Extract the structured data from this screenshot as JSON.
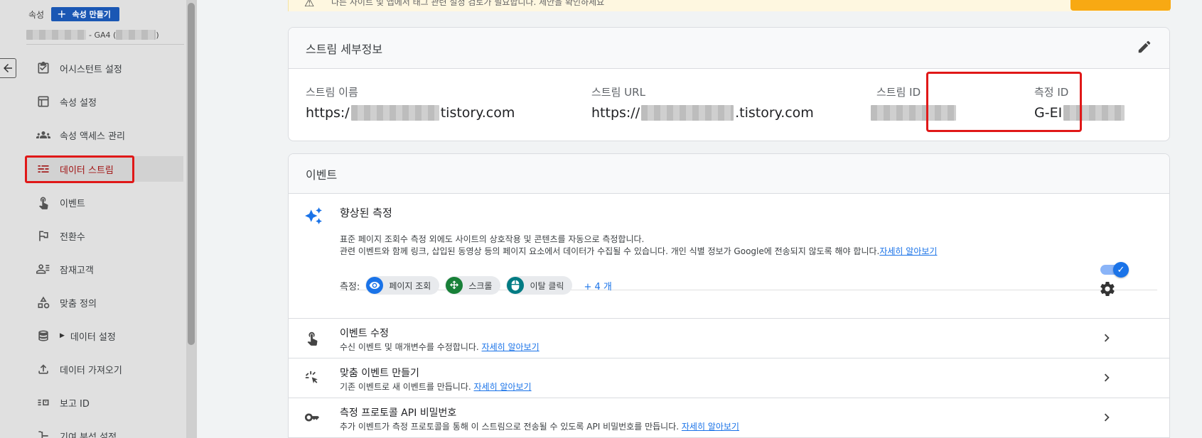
{
  "sidebar": {
    "property_label": "속성",
    "create_button": "속성 만들기",
    "account_suffix": "- GA4 (",
    "account_close": ")",
    "items": [
      {
        "label": "어시스턴트 설정",
        "icon": "checklist-icon"
      },
      {
        "label": "속성 설정",
        "icon": "panel-icon"
      },
      {
        "label": "속성 액세스 관리",
        "icon": "people-icon"
      },
      {
        "label": "데이터 스트림",
        "icon": "streams-icon",
        "active": true
      },
      {
        "label": "이벤트",
        "icon": "touch-icon"
      },
      {
        "label": "전환수",
        "icon": "flag-icon"
      },
      {
        "label": "잠재고객",
        "icon": "audience-icon"
      },
      {
        "label": "맞춤 정의",
        "icon": "shapes-icon"
      },
      {
        "label": "데이터 설정",
        "icon": "database-icon",
        "expandable": true
      },
      {
        "label": "데이터 가져오기",
        "icon": "upload-icon"
      },
      {
        "label": "보고 ID",
        "icon": "report-id-icon"
      },
      {
        "label": "기여 분석 설정",
        "icon": "attribution-icon"
      }
    ]
  },
  "alert": {
    "text": "다른 사이트 및 앱에서 태그 관련 설정 검토가 필요합니다. 제안을 확인하세요"
  },
  "stream_details": {
    "title": "스트림 세부정보",
    "fields": [
      {
        "label": "스트림 이름",
        "prefix": "https:/",
        "suffix": "tistory.com"
      },
      {
        "label": "스트림 URL",
        "prefix": "https://",
        "suffix": ".tistory.com"
      },
      {
        "label": "스트림 ID",
        "prefix": "",
        "suffix": ""
      },
      {
        "label": "측정 ID",
        "prefix": "G-EI",
        "suffix": ""
      }
    ]
  },
  "events": {
    "title": "이벤트",
    "enhanced": {
      "title": "향상된 측정",
      "desc_line1": "표준 페이지 조회수 측정 외에도 사이트의 상호작용 및 콘텐츠를 자동으로 측정합니다.",
      "desc_line2": "관련 이벤트와 함께 링크, 삽입된 동영상 등의 페이지 요소에서 데이터가 수집될 수 있습니다. 개인 식별 정보가 Google에 전송되지 않도록 해야 합니다.",
      "learn_more": "자세히 알아보기",
      "measure_label": "측정:",
      "chips": [
        {
          "label": "페이지 조회",
          "color": "#1a73e8"
        },
        {
          "label": "스크롤",
          "color": "#188038"
        },
        {
          "label": "이탈 클릭",
          "color": "#007b83"
        }
      ],
      "more": "+ 4 개",
      "toggle_on": true
    },
    "rows": [
      {
        "title": "이벤트 수정",
        "desc": "수신 이벤트 및 매개변수를 수정합니다. ",
        "link": "자세히 알아보기"
      },
      {
        "title": "맞춤 이벤트 만들기",
        "desc": "기존 이벤트로 새 이벤트를 만듭니다. ",
        "link": "자세히 알아보기"
      },
      {
        "title": "측정 프로토콜 API 비밀번호",
        "desc": "추가 이벤트가 측정 프로토콜을 통해 이 스트림으로 전송될 수 있도록 API 비밀번호를 만듭니다. ",
        "link": "자세히 알아보기"
      }
    ]
  },
  "colors": {
    "accent": "#1a73e8",
    "highlight": "#e01818",
    "active_text": "#a11414"
  }
}
